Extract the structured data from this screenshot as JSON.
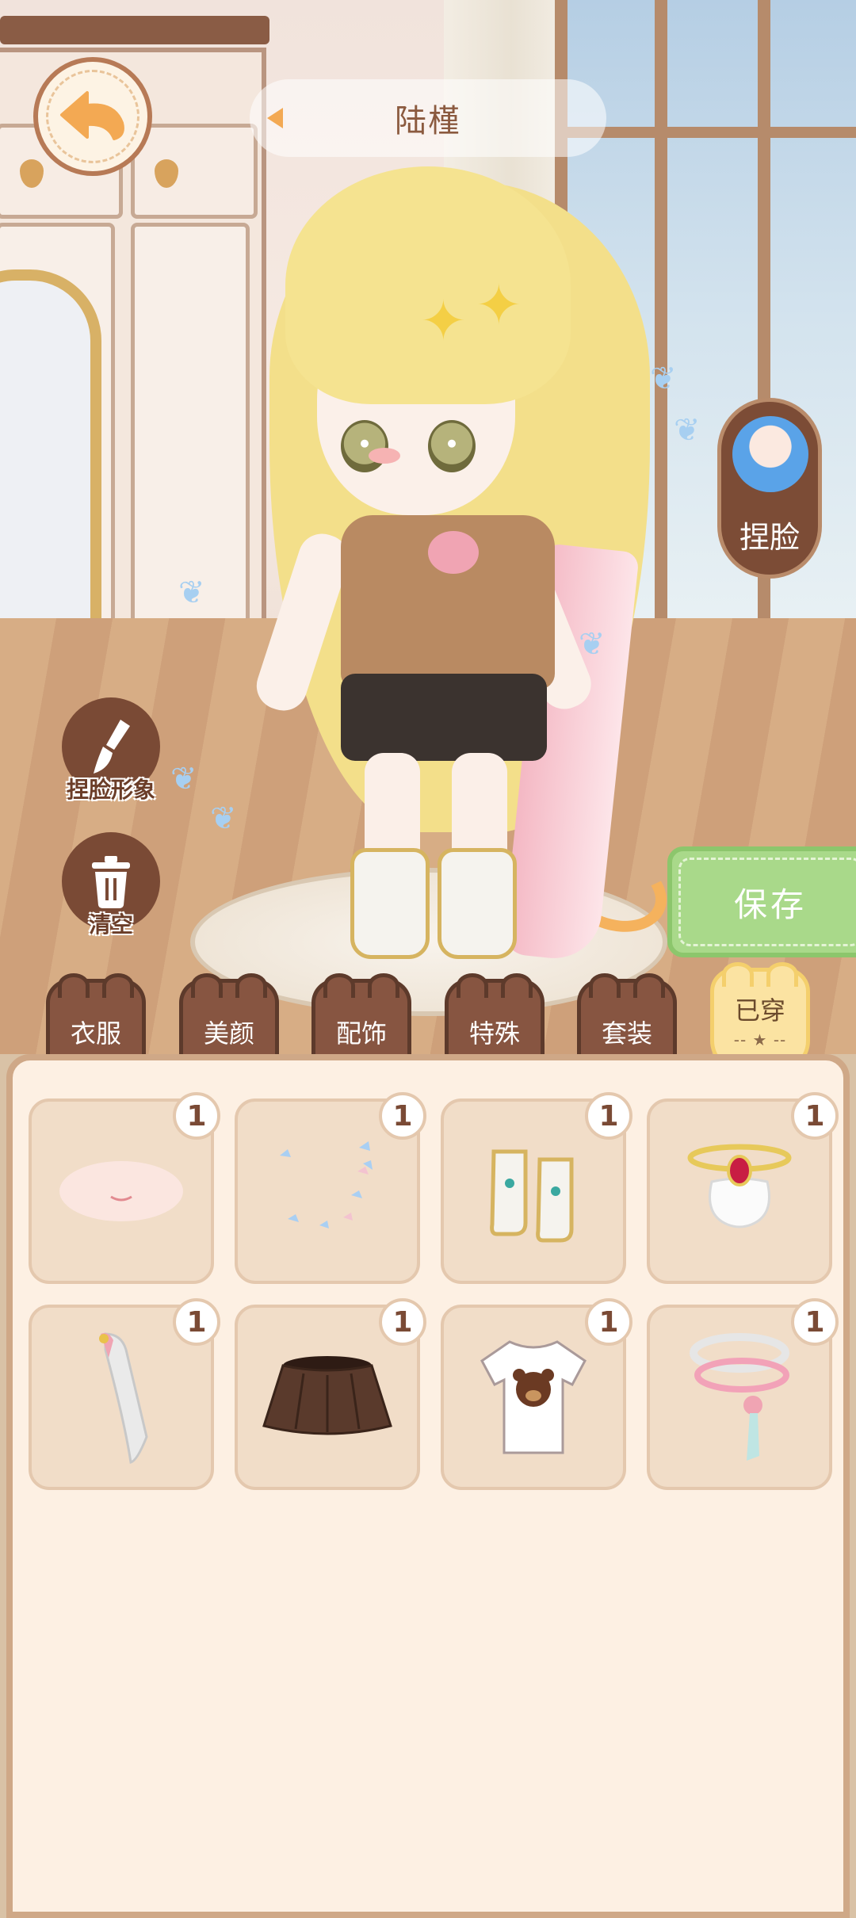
{
  "header": {
    "character_name": "陆槿"
  },
  "side": {
    "face_button_label": "捏脸",
    "save_label": "保存"
  },
  "tools": {
    "face_image_label": "捏脸形象",
    "clear_label": "清空"
  },
  "tabs": [
    {
      "label": "衣服"
    },
    {
      "label": "美颜"
    },
    {
      "label": "配饰"
    },
    {
      "label": "特殊"
    },
    {
      "label": "套装"
    },
    {
      "label": "已穿",
      "active": true,
      "sub": "-- ★ --"
    }
  ],
  "items": [
    {
      "icon": "mouth-blush-icon",
      "count": "1"
    },
    {
      "icon": "butterflies-icon",
      "count": "1"
    },
    {
      "icon": "boots-icon",
      "count": "1"
    },
    {
      "icon": "gem-collar-icon",
      "count": "1"
    },
    {
      "icon": "ribbon-cape-icon",
      "count": "1"
    },
    {
      "icon": "brown-skirt-icon",
      "count": "1"
    },
    {
      "icon": "bear-tshirt-icon",
      "count": "1"
    },
    {
      "icon": "bracelets-icon",
      "count": "1"
    }
  ],
  "colors": {
    "accent": "#f3a953",
    "save_green": "#a9d98a",
    "tab_brown": "#875541",
    "panel_bg": "#fdf0e3"
  }
}
